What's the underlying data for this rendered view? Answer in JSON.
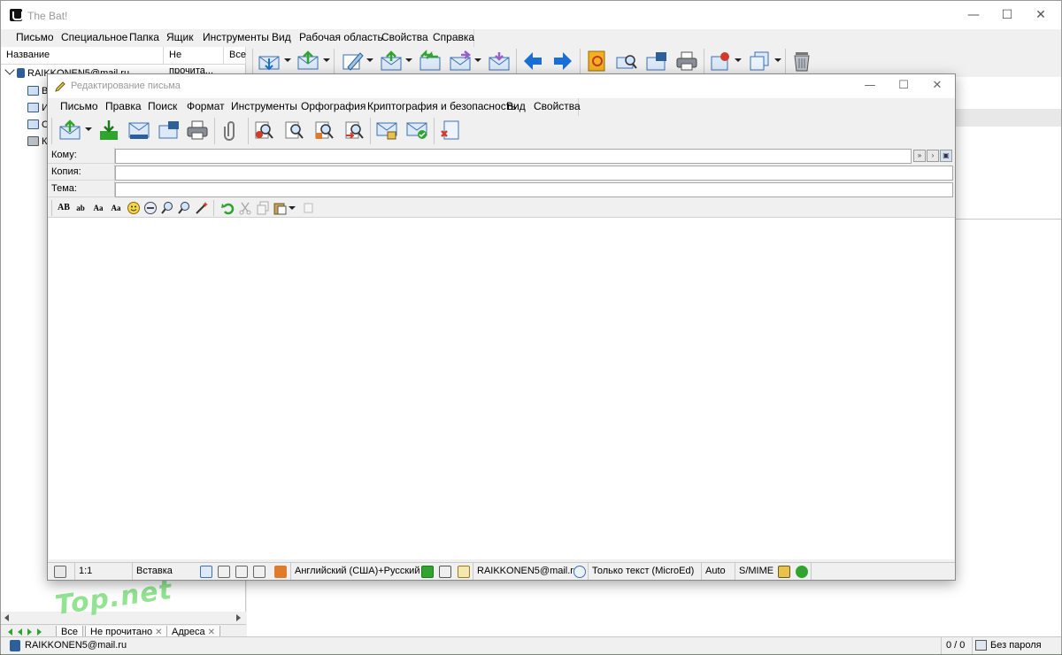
{
  "app": {
    "title": "The Bat!",
    "menu": [
      "Письмо",
      "Специальное",
      "Папка",
      "Ящик",
      "Инструменты",
      "Вид",
      "Рабочая область",
      "Свойства",
      "Справка"
    ],
    "window_controls": {
      "minimize": "—",
      "maximize": "☐",
      "close": "✕"
    }
  },
  "folder_pane": {
    "col_name": "Название",
    "col_unread": "Не прочита...",
    "col_all": "Все",
    "account": "RAIKKONEN5@mail.ru",
    "folders": [
      "В",
      "И",
      "О",
      "К"
    ],
    "tabs": [
      "Все",
      "Не прочитано",
      "Адреса"
    ],
    "tab_close": "✕"
  },
  "main_status": {
    "account": "RAIKKONEN5@mail.ru",
    "count": "0 / 0",
    "password": "Без пароля"
  },
  "watermark": "Top.net",
  "compose": {
    "title": "Редактирование письма",
    "menu": [
      "Письмо",
      "Правка",
      "Поиск",
      "Формат",
      "Инструменты",
      "Орфография",
      "Криптография и безопасность",
      "Вид",
      "Свойства"
    ],
    "fields": {
      "to_label": "Кому:",
      "cc_label": "Копия:",
      "subject_label": "Тема:",
      "to_value": "",
      "cc_value": "",
      "subject_value": ""
    },
    "format_bar": {
      "ab_upper": "AB",
      "ab_lower": "ab",
      "aa_small": "Aa",
      "aa": "Aa"
    },
    "body": "",
    "status": {
      "position": "1:1",
      "mode": "Вставка",
      "language": "Английский (США)+Русский",
      "account": "RAIKKONEN5@mail.ru",
      "format": "Только текст (MicroEd)",
      "charset": "Auto",
      "security": "S/MIME"
    }
  },
  "colors": {
    "accent_blue": "#1a6fd6",
    "green": "#2fa52f",
    "red": "#d23b2b"
  }
}
